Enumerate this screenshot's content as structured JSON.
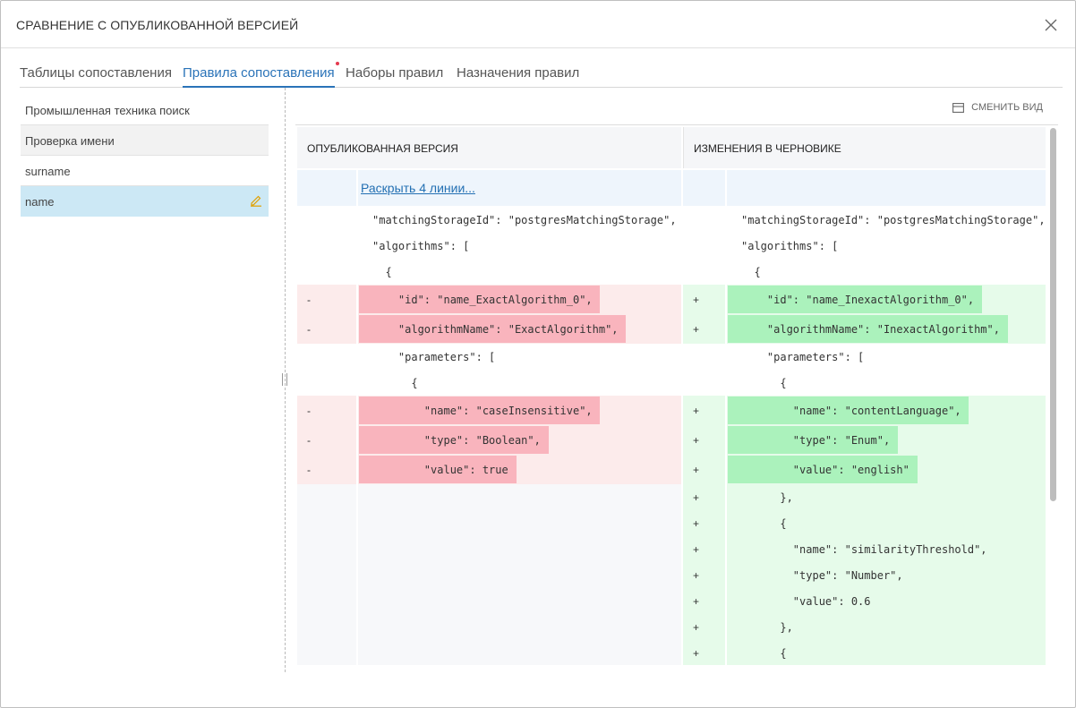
{
  "dialog": {
    "title": "СРАВНЕНИЕ С ОПУБЛИКОВАННОЙ ВЕРСИЕЙ",
    "close_icon": "close-icon"
  },
  "tabs": [
    {
      "label": "Таблицы сопоставления",
      "active": false
    },
    {
      "label": "Правила сопоставления",
      "active": true,
      "has_dot": true
    },
    {
      "label": "Наборы правил",
      "active": false
    },
    {
      "label": "Назначения правил",
      "active": false
    }
  ],
  "rules_list": [
    {
      "label": "Промышленная техника поиск"
    },
    {
      "label": "Проверка имени"
    },
    {
      "label": "surname"
    },
    {
      "label": "name",
      "selected": true,
      "edit_icon": "pencil-icon"
    }
  ],
  "toolbar": {
    "switch_view_label": "СМЕНИТЬ ВИД",
    "switch_view_icon": "layout-icon"
  },
  "diff": {
    "published_header": "ОПУБЛИКОВАННАЯ ВЕРСИЯ",
    "draft_header": "ИЗМЕНЕНИЯ В ЧЕРНОВИКЕ",
    "expand_label": "Раскрыть 4 линии...",
    "rows": [
      {
        "type": "ctx",
        "left": "\"matchingStorageId\": \"postgresMatchingStorage\",",
        "right": "\"matchingStorageId\": \"postgresMatchingStorage\","
      },
      {
        "type": "ctx",
        "left": "\"algorithms\": [",
        "right": "\"algorithms\": ["
      },
      {
        "type": "ctx",
        "left": "  {",
        "right": "  {"
      },
      {
        "type": "chg",
        "left_sign": "-",
        "left": "    \"id\": \"name_ExactAlgorithm_0\",",
        "right_sign": "+",
        "right": "    \"id\": \"name_InexactAlgorithm_0\","
      },
      {
        "type": "chg",
        "left_sign": "-",
        "left": "    \"algorithmName\": \"ExactAlgorithm\",",
        "right_sign": "+",
        "right": "    \"algorithmName\": \"InexactAlgorithm\","
      },
      {
        "type": "ctx",
        "left": "    \"parameters\": [",
        "right": "    \"parameters\": ["
      },
      {
        "type": "ctx",
        "left": "      {",
        "right": "      {"
      },
      {
        "type": "chg",
        "left_sign": "-",
        "left": "        \"name\": \"caseInsensitive\",",
        "right_sign": "+",
        "right": "        \"name\": \"contentLanguage\","
      },
      {
        "type": "chg",
        "left_sign": "-",
        "left": "        \"type\": \"Boolean\",",
        "right_sign": "+",
        "right": "        \"type\": \"Enum\","
      },
      {
        "type": "chg",
        "left_sign": "-",
        "left": "        \"value\": true",
        "right_sign": "+",
        "right": "        \"value\": \"english\""
      },
      {
        "type": "add",
        "right_sign": "+",
        "right": "      },"
      },
      {
        "type": "add",
        "right_sign": "+",
        "right": "      {"
      },
      {
        "type": "add",
        "right_sign": "+",
        "right": "        \"name\": \"similarityThreshold\","
      },
      {
        "type": "add",
        "right_sign": "+",
        "right": "        \"type\": \"Number\","
      },
      {
        "type": "add",
        "right_sign": "+",
        "right": "        \"value\": 0.6"
      },
      {
        "type": "add",
        "right_sign": "+",
        "right": "      },"
      },
      {
        "type": "add",
        "right_sign": "+",
        "right": "      {"
      }
    ]
  }
}
